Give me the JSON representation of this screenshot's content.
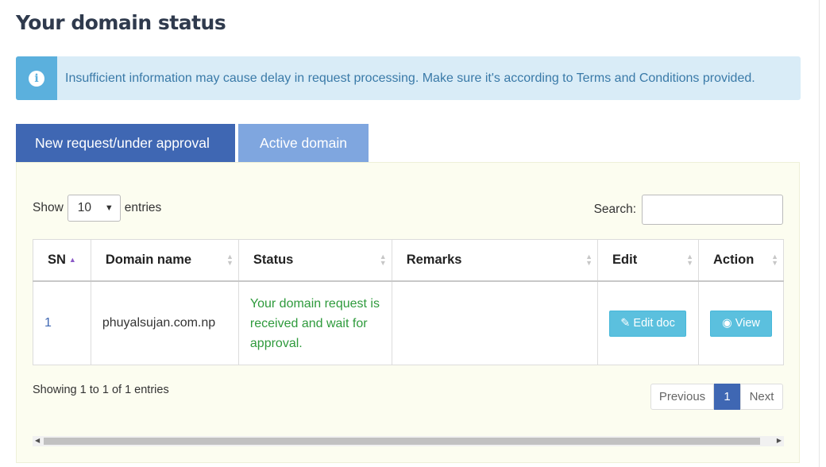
{
  "page": {
    "title": "Your domain status",
    "alert": "Insufficient information may cause delay in request processing. Make sure it's according to Terms and Conditions provided."
  },
  "tabs": [
    {
      "label": "New request/under approval",
      "active": true
    },
    {
      "label": "Active domain",
      "active": false
    }
  ],
  "table_controls": {
    "show_label": "Show",
    "entries_value": "10",
    "entries_label": "entries",
    "search_label": "Search:",
    "search_value": ""
  },
  "table": {
    "columns": [
      "SN",
      "Domain name",
      "Status",
      "Remarks",
      "Edit",
      "Action"
    ],
    "rows": [
      {
        "sn": "1",
        "domain": "phuyalsujan.com.np",
        "status": "Your domain request is received and wait for approval.",
        "remarks": "",
        "edit_label": "Edit doc",
        "action_label": "View"
      }
    ]
  },
  "footer": {
    "info": "Showing 1 to 1 of 1 entries",
    "prev": "Previous",
    "page": "1",
    "next": "Next"
  },
  "icons": {
    "alert": "info-circle-icon",
    "edit": "edit-icon",
    "view": "eye-icon"
  },
  "colors": {
    "active_tab": "#3f67b3",
    "inactive_tab": "#7fa6df",
    "alert_bg": "#d9ecf7",
    "alert_icon_bg": "#5bb0dd",
    "status_text": "#2e9a3c",
    "button": "#5bc0de"
  }
}
